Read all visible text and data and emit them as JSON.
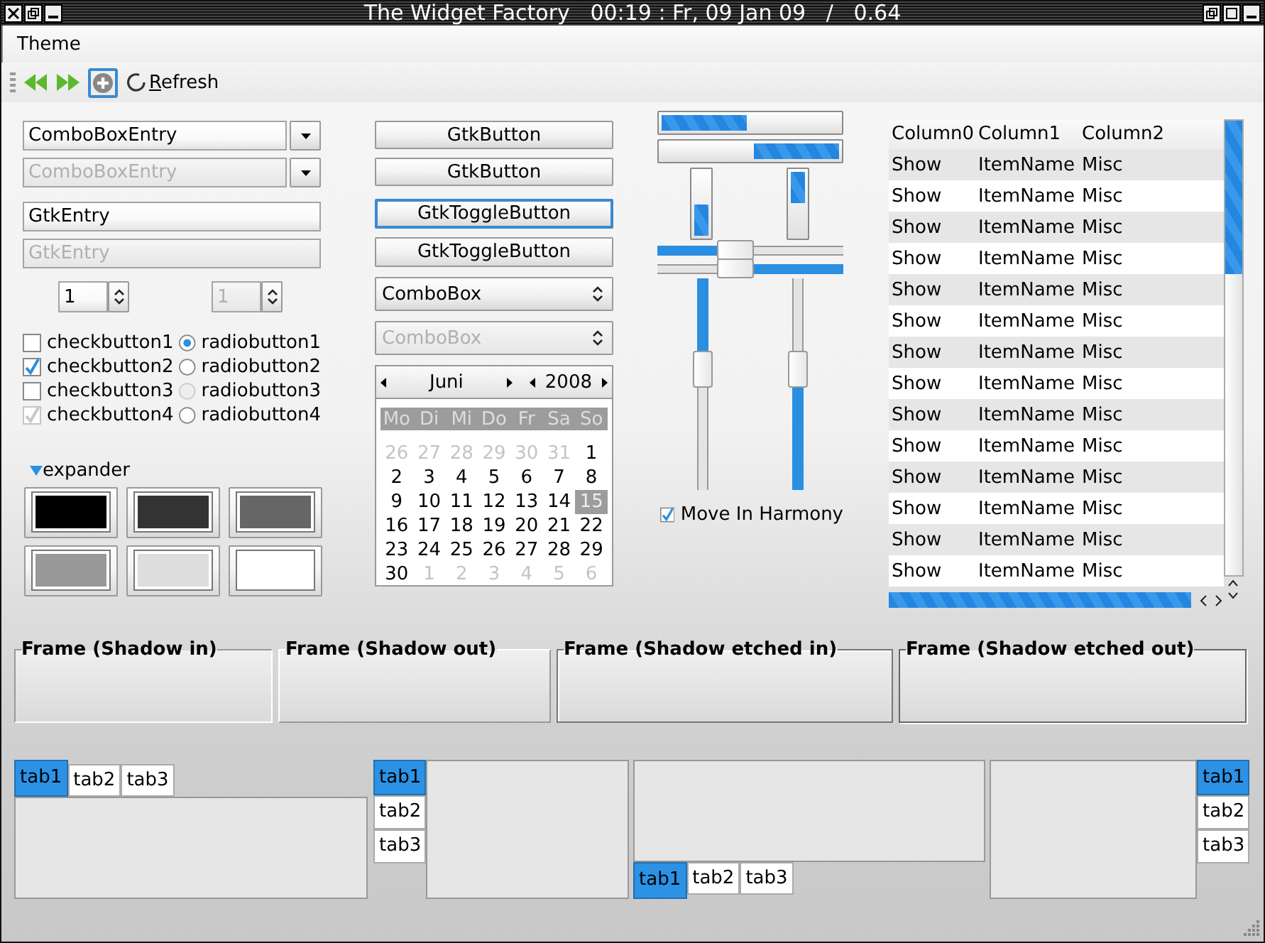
{
  "window": {
    "title": "The Widget Factory   00:19 : Fr, 09 Jan 09   /   0.64"
  },
  "menu": [
    {
      "label": "Theme"
    }
  ],
  "toolbar": {
    "refresh_label": "Refresh"
  },
  "combo_entries": [
    {
      "value": "ComboBoxEntry",
      "disabled": false
    },
    {
      "value": "ComboBoxEntry",
      "disabled": true
    }
  ],
  "entries": [
    {
      "value": "GtkEntry",
      "disabled": false
    },
    {
      "value": "GtkEntry",
      "disabled": true
    }
  ],
  "spin_buttons": [
    {
      "value": "1",
      "disabled": false
    },
    {
      "value": "1",
      "disabled": true
    }
  ],
  "check_buttons": [
    {
      "label": "checkbutton1",
      "checked": false,
      "disabled": false
    },
    {
      "label": "checkbutton2",
      "checked": true,
      "disabled": false
    },
    {
      "label": "checkbutton3",
      "checked": false,
      "disabled": false
    },
    {
      "label": "checkbutton4",
      "checked": true,
      "disabled": true
    }
  ],
  "radio_buttons": [
    {
      "label": "radiobutton1",
      "selected": true,
      "disabled": false
    },
    {
      "label": "radiobutton2",
      "selected": false,
      "disabled": false
    },
    {
      "label": "radiobutton3",
      "selected": false,
      "disabled": true
    },
    {
      "label": "radiobutton4",
      "selected": false,
      "disabled": false
    }
  ],
  "expander": {
    "label": "expander",
    "expanded": true
  },
  "color_buttons": [
    {
      "color": "#000000"
    },
    {
      "color": "#333333"
    },
    {
      "color": "#666666"
    },
    {
      "color": "#999999"
    },
    {
      "color": "#dddddd"
    },
    {
      "color": "#ffffff"
    }
  ],
  "buttons": [
    {
      "label": "GtkButton"
    },
    {
      "label": "GtkButton"
    }
  ],
  "toggle_buttons": [
    {
      "label": "GtkToggleButton",
      "focused": true
    },
    {
      "label": "GtkToggleButton",
      "focused": false
    }
  ],
  "combo_boxes": [
    {
      "value": "ComboBox",
      "disabled": false
    },
    {
      "value": "ComboBox",
      "disabled": true
    }
  ],
  "calendar": {
    "month": "Juni",
    "year": "2008",
    "weekdays": [
      "Mo",
      "Di",
      "Mi",
      "Do",
      "Fr",
      "Sa",
      "So"
    ],
    "days": [
      {
        "day": "26",
        "other_month": true,
        "selected": false
      },
      {
        "day": "27",
        "other_month": true,
        "selected": false
      },
      {
        "day": "28",
        "other_month": true,
        "selected": false
      },
      {
        "day": "29",
        "other_month": true,
        "selected": false
      },
      {
        "day": "30",
        "other_month": true,
        "selected": false
      },
      {
        "day": "31",
        "other_month": true,
        "selected": false
      },
      {
        "day": "1",
        "other_month": false,
        "selected": false
      },
      {
        "day": "2",
        "other_month": false,
        "selected": false
      },
      {
        "day": "3",
        "other_month": false,
        "selected": false
      },
      {
        "day": "4",
        "other_month": false,
        "selected": false
      },
      {
        "day": "5",
        "other_month": false,
        "selected": false
      },
      {
        "day": "6",
        "other_month": false,
        "selected": false
      },
      {
        "day": "7",
        "other_month": false,
        "selected": false
      },
      {
        "day": "8",
        "other_month": false,
        "selected": false
      },
      {
        "day": "9",
        "other_month": false,
        "selected": false
      },
      {
        "day": "10",
        "other_month": false,
        "selected": false
      },
      {
        "day": "11",
        "other_month": false,
        "selected": false
      },
      {
        "day": "12",
        "other_month": false,
        "selected": false
      },
      {
        "day": "13",
        "other_month": false,
        "selected": false
      },
      {
        "day": "14",
        "other_month": false,
        "selected": false
      },
      {
        "day": "15",
        "other_month": false,
        "selected": true
      },
      {
        "day": "16",
        "other_month": false,
        "selected": false
      },
      {
        "day": "17",
        "other_month": false,
        "selected": false
      },
      {
        "day": "18",
        "other_month": false,
        "selected": false
      },
      {
        "day": "19",
        "other_month": false,
        "selected": false
      },
      {
        "day": "20",
        "other_month": false,
        "selected": false
      },
      {
        "day": "21",
        "other_month": false,
        "selected": false
      },
      {
        "day": "22",
        "other_month": false,
        "selected": false
      },
      {
        "day": "23",
        "other_month": false,
        "selected": false
      },
      {
        "day": "24",
        "other_month": false,
        "selected": false
      },
      {
        "day": "25",
        "other_month": false,
        "selected": false
      },
      {
        "day": "26",
        "other_month": false,
        "selected": false
      },
      {
        "day": "27",
        "other_month": false,
        "selected": false
      },
      {
        "day": "28",
        "other_month": false,
        "selected": false
      },
      {
        "day": "29",
        "other_month": false,
        "selected": false
      },
      {
        "day": "30",
        "other_month": false,
        "selected": false
      },
      {
        "day": "1",
        "other_month": true,
        "selected": false
      },
      {
        "day": "2",
        "other_month": true,
        "selected": false
      },
      {
        "day": "3",
        "other_month": true,
        "selected": false
      },
      {
        "day": "4",
        "other_month": true,
        "selected": false
      },
      {
        "day": "5",
        "other_month": true,
        "selected": false
      },
      {
        "day": "6",
        "other_month": true,
        "selected": false
      }
    ]
  },
  "progress_bars": [
    {
      "kind": "left-to-right",
      "level": 0.48
    },
    {
      "kind": "right-to-left",
      "level": 0.48
    },
    {
      "kind": "bottom-to-top",
      "level": 0.48
    },
    {
      "kind": "top-to-bottom",
      "level": 0.48
    }
  ],
  "scales": [
    {
      "kind": "horizontal",
      "inverted": false,
      "level": 0.42
    },
    {
      "kind": "horizontal",
      "inverted": true,
      "level": 0.58
    },
    {
      "kind": "vertical",
      "inverted": false,
      "level": 0.43
    },
    {
      "kind": "vertical",
      "inverted": true,
      "level": 0.57
    }
  ],
  "move_in_harmony": {
    "label": "Move In Harmony",
    "checked": true
  },
  "tree": {
    "columns": [
      "Column0",
      "Column1",
      "Column2"
    ],
    "rows": [
      {
        "cells": [
          "Show",
          "ItemName",
          "Misc"
        ]
      },
      {
        "cells": [
          "Show",
          "ItemName",
          "Misc"
        ]
      },
      {
        "cells": [
          "Show",
          "ItemName",
          "Misc"
        ]
      },
      {
        "cells": [
          "Show",
          "ItemName",
          "Misc"
        ]
      },
      {
        "cells": [
          "Show",
          "ItemName",
          "Misc"
        ]
      },
      {
        "cells": [
          "Show",
          "ItemName",
          "Misc"
        ]
      },
      {
        "cells": [
          "Show",
          "ItemName",
          "Misc"
        ]
      },
      {
        "cells": [
          "Show",
          "ItemName",
          "Misc"
        ]
      },
      {
        "cells": [
          "Show",
          "ItemName",
          "Misc"
        ]
      },
      {
        "cells": [
          "Show",
          "ItemName",
          "Misc"
        ]
      },
      {
        "cells": [
          "Show",
          "ItemName",
          "Misc"
        ]
      },
      {
        "cells": [
          "Show",
          "ItemName",
          "Misc"
        ]
      },
      {
        "cells": [
          "Show",
          "ItemName",
          "Misc"
        ]
      },
      {
        "cells": [
          "Show",
          "ItemName",
          "Misc"
        ]
      }
    ]
  },
  "frames": [
    {
      "label": "Frame (Shadow in)",
      "kind": "in"
    },
    {
      "label": "Frame (Shadow out)",
      "kind": "out"
    },
    {
      "label": "Frame (Shadow etched in)",
      "kind": "etched-in"
    },
    {
      "label": "Frame (Shadow etched out)",
      "kind": "etched-out"
    }
  ],
  "notebooks": [
    {
      "kind": "top",
      "tabs": [
        {
          "label": "tab1",
          "selected": true
        },
        {
          "label": "tab2",
          "selected": false
        },
        {
          "label": "tab3",
          "selected": false
        }
      ]
    },
    {
      "kind": "left",
      "tabs": [
        {
          "label": "tab1",
          "selected": true
        },
        {
          "label": "tab2",
          "selected": false
        },
        {
          "label": "tab3",
          "selected": false
        }
      ]
    },
    {
      "kind": "bottom",
      "tabs": [
        {
          "label": "tab1",
          "selected": true
        },
        {
          "label": "tab2",
          "selected": false
        },
        {
          "label": "tab3",
          "selected": false
        }
      ]
    },
    {
      "kind": "right",
      "tabs": [
        {
          "label": "tab1",
          "selected": true
        },
        {
          "label": "tab2",
          "selected": false
        },
        {
          "label": "tab3",
          "selected": false
        }
      ]
    }
  ]
}
